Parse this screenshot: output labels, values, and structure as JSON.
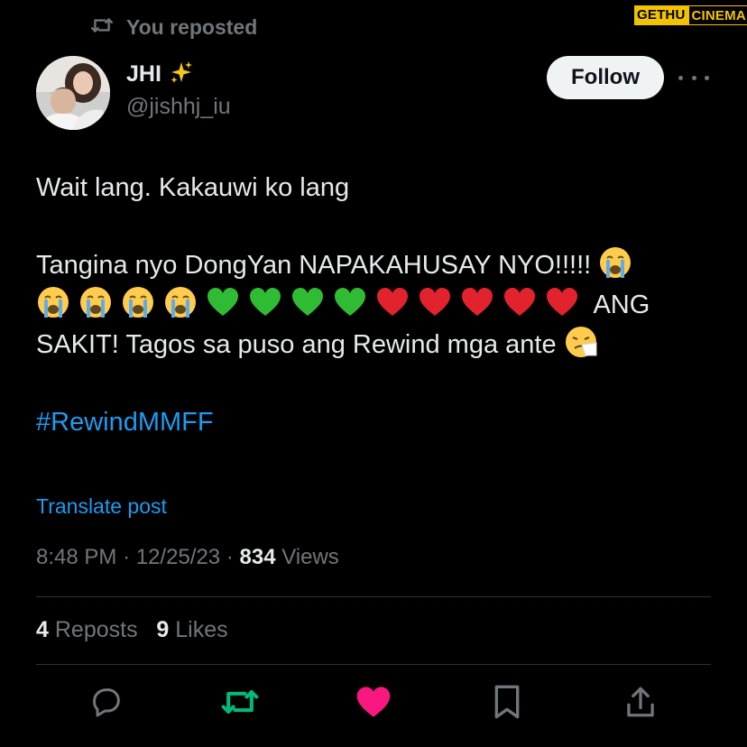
{
  "watermark": {
    "part1": "GETHU",
    "part2": "CINEMA"
  },
  "repost": {
    "icon": "repost-icon",
    "text": "You reposted"
  },
  "author": {
    "name": "JHI",
    "badge_emoji": "sparkles",
    "handle": "@jishhj_iu"
  },
  "follow_label": "Follow",
  "more_icon": "more-options-icon",
  "tweet": {
    "line1": "Wait lang. Kakauwi ko lang",
    "line2_start": "Tangina nyo DongYan NAPAKAHUSAY NYO!!!!!",
    "emojis_row": [
      "crying",
      "crying",
      "crying",
      "crying",
      "crying",
      "green-heart",
      "green-heart",
      "green-heart",
      "green-heart",
      "red-heart",
      "red-heart",
      "red-heart",
      "red-heart",
      "red-heart"
    ],
    "line2_mid": "ANG",
    "line2_end": "SAKIT! Tagos sa puso ang Rewind mga ante",
    "end_emoji": "sneezing-face",
    "hashtag": "#RewindMMFF"
  },
  "translate_label": "Translate post",
  "meta": {
    "time": "8:48 PM",
    "sep": "·",
    "date": "12/25/23",
    "views_count": "834",
    "views_label": "Views"
  },
  "stats": {
    "reposts_count": "4",
    "reposts_label": "Reposts",
    "likes_count": "9",
    "likes_label": "Likes"
  },
  "actions": [
    "reply-icon",
    "repost-icon",
    "like-icon",
    "bookmark-icon",
    "share-icon"
  ],
  "colors": {
    "background": "#000000",
    "text": "#e7e9ea",
    "muted": "#71767b",
    "link": "#1d9bf0",
    "repost_active": "#00ba7c",
    "like_active": "#f91880"
  }
}
